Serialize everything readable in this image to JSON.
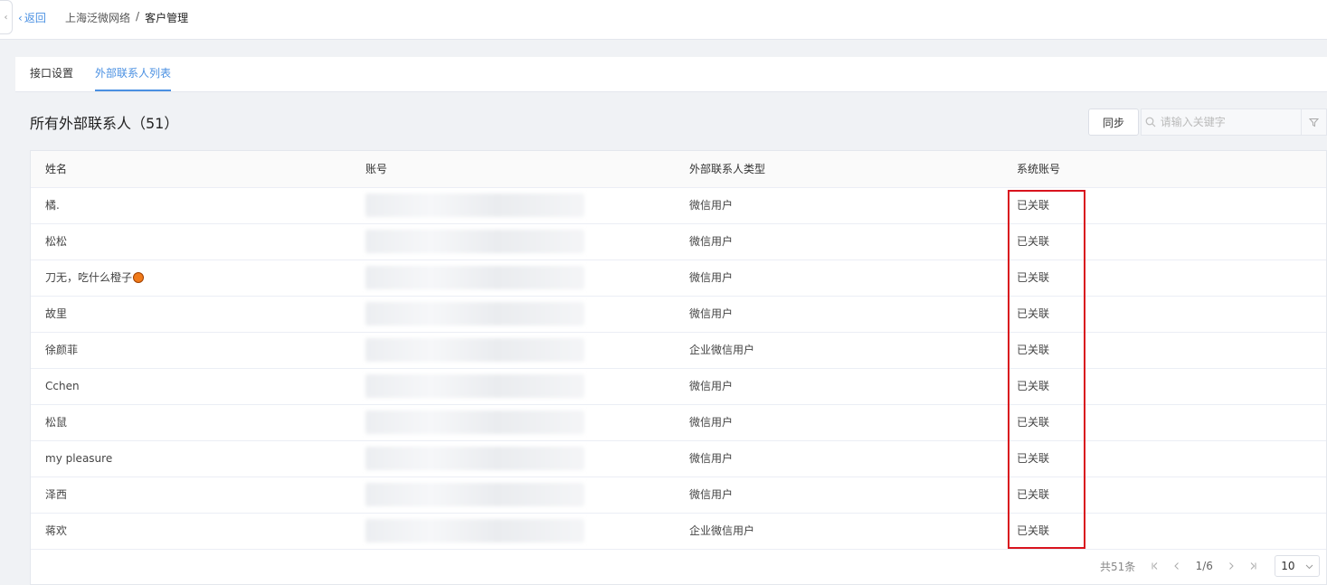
{
  "header": {
    "back_label": "返回",
    "breadcrumb": [
      "上海泛微网络",
      "客户管理"
    ],
    "separator": "/"
  },
  "tabs": [
    {
      "label": "接口设置",
      "active": false
    },
    {
      "label": "外部联系人列表",
      "active": true
    }
  ],
  "list": {
    "title": "所有外部联系人（51）",
    "sync_label": "同步",
    "search_placeholder": "请输入关键字"
  },
  "table": {
    "columns": [
      "姓名",
      "账号",
      "外部联系人类型",
      "系统账号"
    ],
    "rows": [
      {
        "name": "橘.",
        "type": "微信用户",
        "status": "已关联"
      },
      {
        "name": "松松",
        "type": "微信用户",
        "status": "已关联"
      },
      {
        "name": "刀无，吃什么橙子",
        "type": "微信用户",
        "status": "已关联"
      },
      {
        "name": "故里",
        "type": "微信用户",
        "status": "已关联"
      },
      {
        "name": "徐颜菲",
        "type": "企业微信用户",
        "status": "已关联"
      },
      {
        "name": "Cchen",
        "type": "微信用户",
        "status": "已关联"
      },
      {
        "name": "松鼠",
        "type": "微信用户",
        "status": "已关联"
      },
      {
        "name": "my pleasure",
        "type": "微信用户",
        "status": "已关联"
      },
      {
        "name": "泽西",
        "type": "微信用户",
        "status": "已关联"
      },
      {
        "name": "蒋欢",
        "type": "企业微信用户",
        "status": "已关联"
      }
    ]
  },
  "pagination": {
    "total_label": "共51条",
    "page_label": "1/6",
    "page_size": "10"
  },
  "colors": {
    "accent": "#4a90e2",
    "highlight": "#d9141e"
  },
  "icons": {
    "back": "chevron-left-icon",
    "search": "search-icon",
    "filter": "filter-icon",
    "orange_emoji": "tangerine-emoji-icon"
  }
}
